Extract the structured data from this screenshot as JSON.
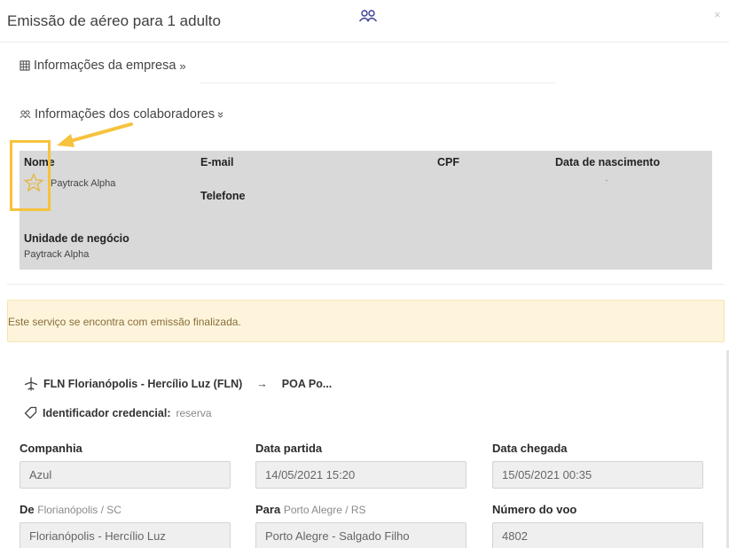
{
  "modal": {
    "title": "Emissão de aéreo para 1 adulto",
    "close": "×"
  },
  "sections": {
    "empresa": "Informações da empresa",
    "empresa_chevron": "»",
    "colaboradores": "Informações dos colaboradores",
    "colaboradores_chevron": "»"
  },
  "collaborators": {
    "headers": {
      "nome": "Nome",
      "email": "E-mail",
      "cpf": "CPF",
      "nascimento": "Data de nascimento",
      "telefone": "Telefone",
      "unidade": "Unidade de negócio"
    },
    "row": {
      "nome": "Paytrack Alpha",
      "unidade": "Paytrack Alpha"
    }
  },
  "alert": {
    "text": "Este serviço se encontra com emissão finalizada."
  },
  "flight": {
    "route_from": "FLN Florianópolis - Hercílio Luz (FLN)",
    "route_arrow": "→",
    "route_to": "POA Po...",
    "credential_label": "Identificador credencial:",
    "credential_value": "reserva",
    "fields": {
      "companhia_label": "Companhia",
      "companhia_value": "Azul",
      "partida_label": "Data partida",
      "partida_value": "14/05/2021 15:20",
      "chegada_label": "Data chegada",
      "chegada_value": "15/05/2021 00:35",
      "de_label": "De",
      "de_city": "Florianópolis / SC",
      "de_value": "Florianópolis - Hercílio Luz",
      "para_label": "Para",
      "para_city": "Porto Alegre / RS",
      "para_value": "Porto Alegre - Salgado Filho",
      "voo_label": "Número do voo",
      "voo_value": "4802"
    }
  },
  "icons": {
    "people": "people-icon",
    "building": "building-icon",
    "star": "star-icon",
    "plane": "plane-icon",
    "tag": "tag-icon"
  },
  "colors": {
    "highlight": "#f7c23c",
    "alert_bg": "#fdf4db",
    "alert_text": "#8a6d3b",
    "card_bg": "#d9d9d9"
  }
}
